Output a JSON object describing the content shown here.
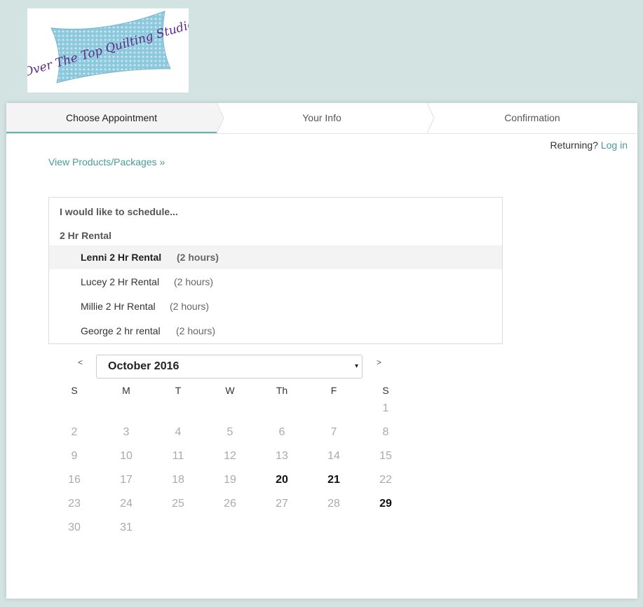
{
  "logo": {
    "text": "Over The Top Quilting Studio"
  },
  "steps": [
    {
      "label": "Choose Appointment",
      "active": true
    },
    {
      "label": "Your Info",
      "active": false
    },
    {
      "label": "Confirmation",
      "active": false
    }
  ],
  "returning": {
    "prompt": "Returning?",
    "login_label": "Log in"
  },
  "view_products_label": "View Products/Packages »",
  "schedule": {
    "heading": "I would like to schedule...",
    "category": "2 Hr Rental",
    "items": [
      {
        "name": "Lenni 2 Hr Rental",
        "duration": "(2 hours)",
        "selected": true
      },
      {
        "name": "Lucey 2 Hr Rental",
        "duration": "(2 hours)",
        "selected": false
      },
      {
        "name": "Millie 2 Hr Rental",
        "duration": "(2 hours)",
        "selected": false
      },
      {
        "name": "George 2 hr rental",
        "duration": "(2 hours)",
        "selected": false
      }
    ]
  },
  "calendar": {
    "prev_label": "<",
    "next_label": ">",
    "month_label": "October 2016",
    "caret": "▾",
    "weekdays": [
      "S",
      "M",
      "T",
      "W",
      "Th",
      "F",
      "S"
    ],
    "first_weekday_index": 6,
    "days_in_month": 31,
    "available_days": [
      20,
      21,
      29
    ]
  }
}
